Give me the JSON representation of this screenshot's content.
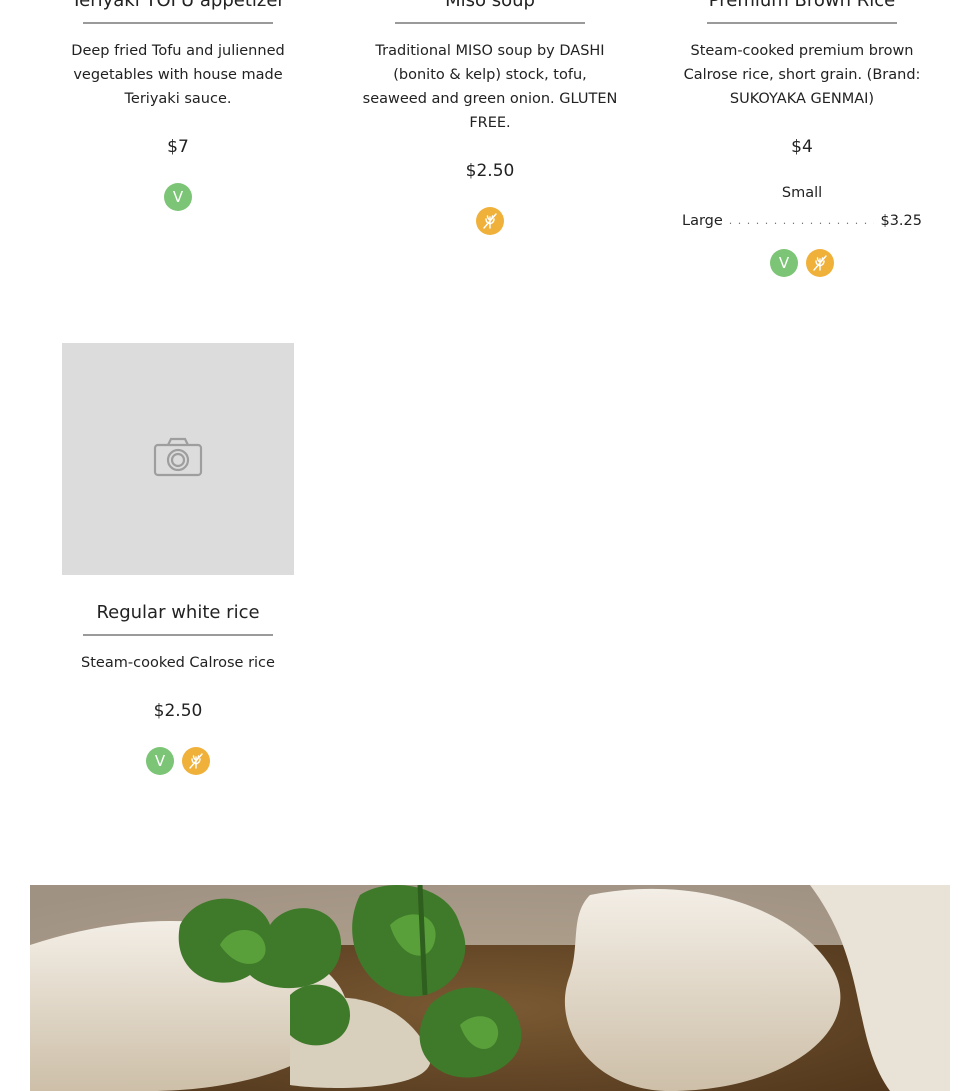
{
  "items": [
    {
      "title": "Teriyaki TOFU appetizer",
      "description": "Deep fried Tofu and julienned vegetables with house made Teriyaki sauce.",
      "price": "$7",
      "badges": [
        "V"
      ]
    },
    {
      "title": "Miso soup",
      "description": "Traditional MISO soup by DASHI (bonito & kelp) stock, tofu, seaweed and green onion. GLUTEN FREE.",
      "price": "$2.50",
      "badges": [
        "gluten-free-icon"
      ]
    },
    {
      "title": "Premium Brown Rice",
      "description": "Steam-cooked premium brown Calrose rice, short grain. (Brand: SUKOYAKA GENMAI)",
      "price": "$4",
      "variants": [
        {
          "name": "Small",
          "price": ""
        },
        {
          "name": "Large",
          "price": "$3.25"
        }
      ],
      "badges": [
        "V",
        "gluten-free-icon"
      ]
    },
    {
      "title": "Regular white rice",
      "description": "Steam-cooked Calrose rice",
      "price": "$2.50",
      "badges": [
        "V",
        "gluten-free-icon"
      ],
      "image": "camera-placeholder-icon"
    }
  ],
  "badge_labels": {
    "vegetarian": "V"
  },
  "colors": {
    "vegetarian_badge": "#7cc576",
    "gluten_free_badge": "#f0b13b",
    "divider": "#9a9a9a",
    "placeholder_bg": "#dcdcdc"
  },
  "banner": {
    "icon": "dumpling-soup-photo"
  }
}
